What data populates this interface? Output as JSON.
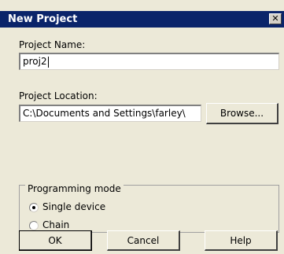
{
  "window": {
    "title": "New Project",
    "close_glyph": "✕"
  },
  "project_name": {
    "label": "Project Name:",
    "value": "proj2"
  },
  "project_location": {
    "label": "Project Location:",
    "value": "C:\\Documents and Settings\\farley\\",
    "browse_label": "Browse..."
  },
  "programming_mode": {
    "legend": "Programming mode",
    "options": [
      {
        "label": "Single device",
        "selected": true
      },
      {
        "label": "Chain",
        "selected": false
      }
    ]
  },
  "buttons": {
    "ok": "OK",
    "cancel": "Cancel",
    "help": "Help"
  }
}
